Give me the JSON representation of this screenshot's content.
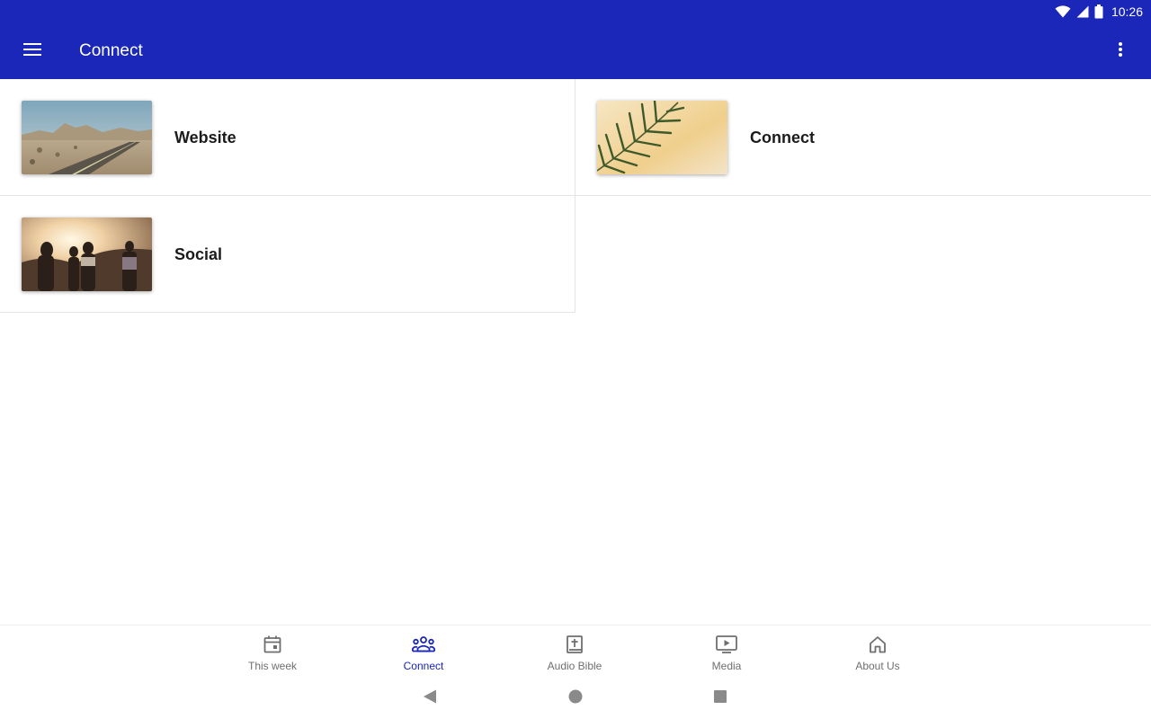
{
  "status_bar": {
    "time": "10:26",
    "icons": [
      "wifi-icon",
      "cell-signal-icon",
      "battery-icon"
    ]
  },
  "app_bar": {
    "title": "Connect",
    "menu_icon": "hamburger-menu-icon",
    "overflow_icon": "more-vert-icon"
  },
  "tiles": [
    {
      "label": "Website",
      "image": "desert-road-image"
    },
    {
      "label": "Connect",
      "image": "palm-leaf-image"
    },
    {
      "label": "Social",
      "image": "sunset-people-image"
    }
  ],
  "bottom_nav": {
    "active": "Connect",
    "items": [
      {
        "label": "This week",
        "icon": "calendar-icon"
      },
      {
        "label": "Connect",
        "icon": "groups-icon"
      },
      {
        "label": "Audio Bible",
        "icon": "bible-icon"
      },
      {
        "label": "Media",
        "icon": "video-player-icon"
      },
      {
        "label": "About Us",
        "icon": "home-icon"
      }
    ]
  },
  "system_nav": {
    "icons": [
      "back-icon",
      "home-circle-icon",
      "recents-icon"
    ]
  },
  "colors": {
    "brand": "#1a27b8",
    "inactive_nav": "#6f6f6f",
    "divider": "#e4e4e4"
  }
}
